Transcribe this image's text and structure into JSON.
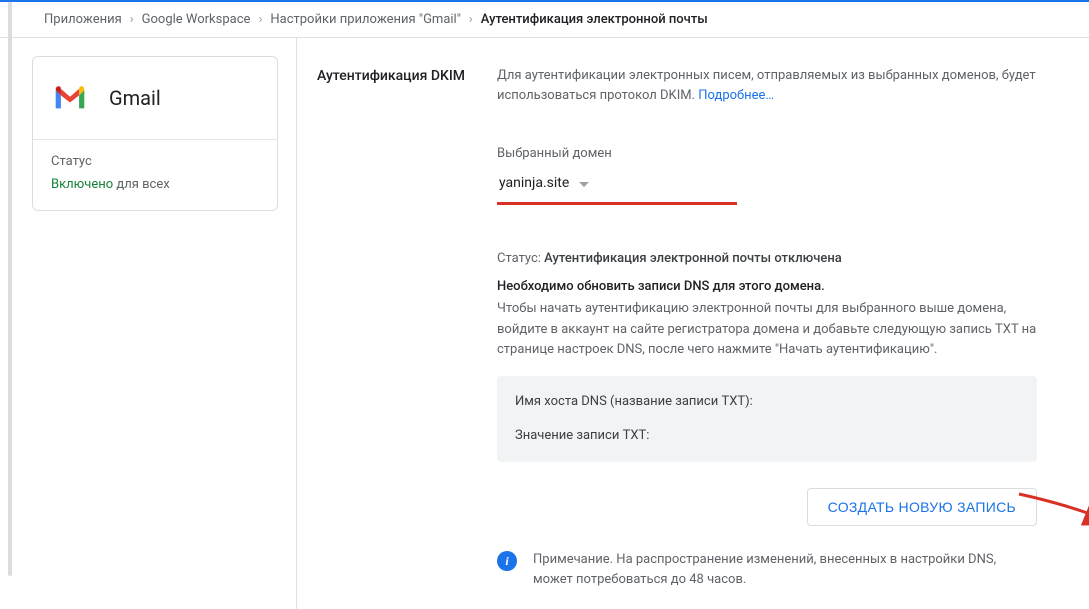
{
  "breadcrumb": {
    "items": [
      "Приложения",
      "Google Workspace",
      "Настройки приложения \"Gmail\""
    ],
    "current": "Аутентификация электронной почты"
  },
  "sidebar": {
    "app_name": "Gmail",
    "status_label": "Статус",
    "status_on": "Включено",
    "status_scope": "для всех"
  },
  "main": {
    "section_title": "Аутентификация DKIM",
    "intro": "Для аутентификации электронных писем, отправляемых из выбранных доменов, будет использоваться протокол DKIM. ",
    "learn_more": "Подробнее…",
    "field_label": "Выбранный домен",
    "domain": "yaninja.site",
    "status_prefix": "Статус: ",
    "status_value": "Аутентификация электронной почты отключена",
    "update_title": "Необходимо обновить записи DNS для этого домена.",
    "update_text": "Чтобы начать аутентификацию электронной почты для выбранного выше домена, войдите в аккаунт на сайте регистратора домена и добавьте следующую запись TXT на странице настроек DNS, после чего нажмите \"Начать аутентификацию\".",
    "dns_host_label": "Имя хоста DNS (название записи TXT):",
    "dns_value_label": "Значение записи TXT:",
    "create_button": "СОЗДАТЬ НОВУЮ ЗАПИСЬ",
    "note": "Примечание. На распространение изменений, внесенных в настройки DNS, может потребоваться до 48 часов."
  }
}
